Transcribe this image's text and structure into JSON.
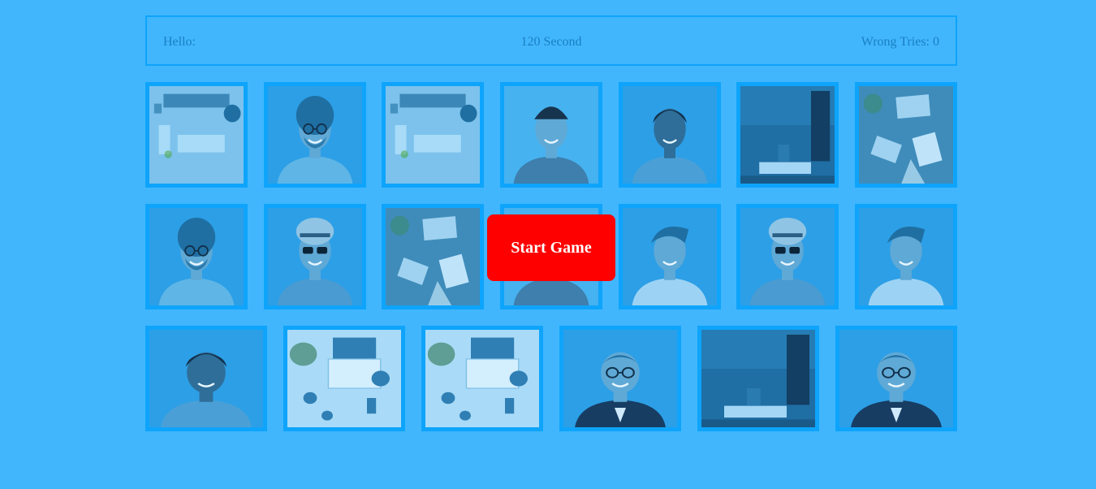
{
  "header": {
    "hello_label": "Hello:",
    "timer_text": "120 Second",
    "wrong_tries_text": "Wrong Tries: 0"
  },
  "start_button_label": "Start Game",
  "colors": {
    "background": "#41b6fd",
    "card_border": "#0ea4fb",
    "button": "#ff0000",
    "text": "#1a7fc2"
  },
  "board": {
    "rows": [
      [
        "workspace-desk",
        "curly-hair-man",
        "workspace-desk",
        "beanie-man",
        "smiling-woman",
        "dark-office-monitor",
        "laptop-desk"
      ],
      [
        "curly-hair-man",
        "sunglasses-hat-man",
        "laptop-desk",
        "beanie-man",
        "laughing-man",
        "sunglasses-hat-man",
        "laughing-man"
      ],
      [
        "smiling-woman",
        "white-desk-flatlay",
        "white-desk-flatlay",
        "suit-glasses-man",
        "dark-office-monitor",
        "suit-glasses-man"
      ]
    ]
  }
}
